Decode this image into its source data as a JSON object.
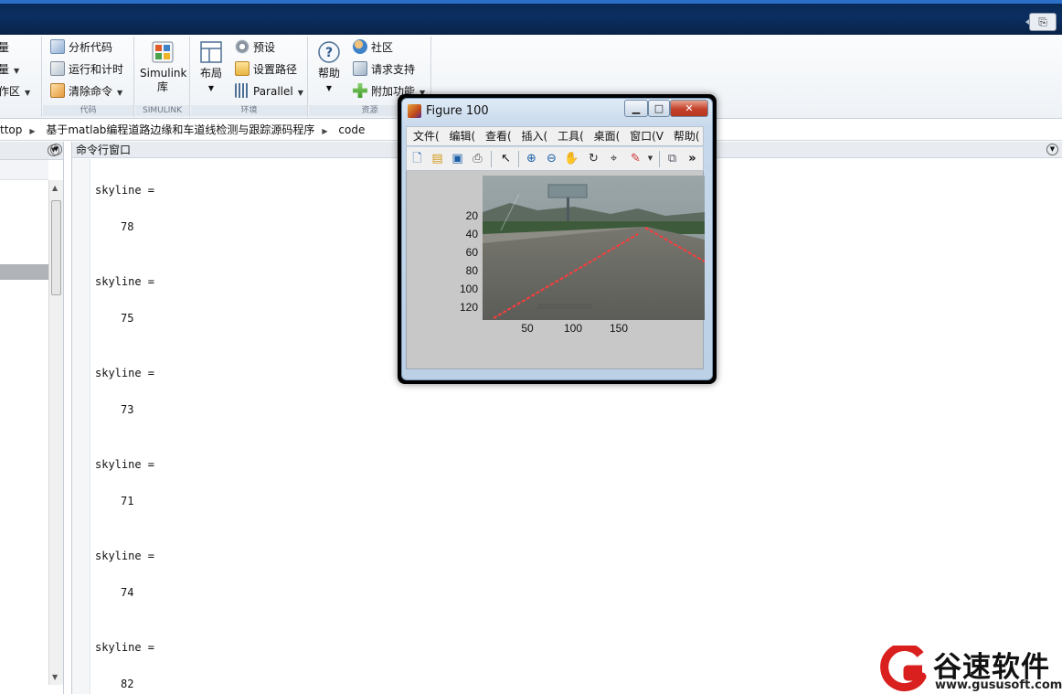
{
  "ribbon": {
    "left_cut_items": [
      "量",
      "量",
      "作区"
    ],
    "code_group": {
      "label": "代码",
      "items": [
        "分析代码",
        "运行和计时",
        "清除命令"
      ]
    },
    "simulink_group": {
      "label": "SIMULINK",
      "button_line1": "Simulink",
      "button_line2": "库"
    },
    "env_group": {
      "label": "环境",
      "layout_button": "布局",
      "items": [
        "预设",
        "设置路径",
        "Parallel"
      ]
    },
    "resources_group": {
      "label": "资源",
      "help_button": "帮助",
      "items": [
        "社区",
        "请求支持",
        "附加功能"
      ]
    }
  },
  "breadcrumb": [
    "ttop",
    "基于matlab编程道路边缘和车道线检测与跟踪源码程序",
    "code"
  ],
  "command_window": {
    "title": "命令行窗口",
    "outputs": [
      {
        "label": "skyline =",
        "value": "78"
      },
      {
        "label": "skyline =",
        "value": "75"
      },
      {
        "label": "skyline =",
        "value": "73"
      },
      {
        "label": "skyline =",
        "value": "71"
      },
      {
        "label": "skyline =",
        "value": "74"
      },
      {
        "label": "skyline =",
        "value": "82"
      }
    ]
  },
  "figure": {
    "title": "Figure 100",
    "menu": [
      "文件(",
      "编辑(",
      "查看(",
      "插入(",
      "工具(",
      "桌面(",
      "窗口(V",
      "帮助("
    ],
    "toolbar_icons": [
      "new-icon",
      "open-icon",
      "save-icon",
      "print-icon",
      "pointer-icon",
      "zoom-in-icon",
      "zoom-out-icon",
      "pan-icon",
      "rotate-icon",
      "data-cursor-icon",
      "brush-icon",
      "link-icon",
      "overflow-icon"
    ],
    "yticks": [
      "20",
      "40",
      "60",
      "80",
      "100",
      "120"
    ],
    "xticks": [
      "50",
      "100",
      "150"
    ],
    "image_desc_colors": {
      "lane_line": "#ff3b3b",
      "road": "#6e6e6a",
      "sky": "#8e9a9c"
    }
  },
  "logo": {
    "name": "谷速软件",
    "url": "www.gususoft.com",
    "brand_color": "#d9201e"
  }
}
